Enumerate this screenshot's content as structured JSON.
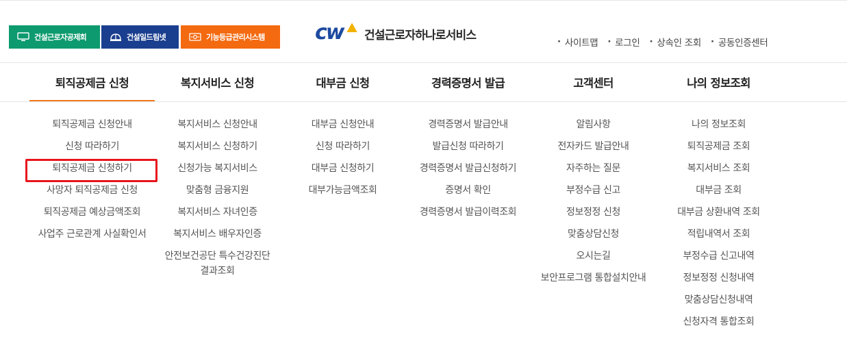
{
  "family_sites": [
    {
      "label": "건설근로자공제회",
      "icon": "monitor-icon"
    },
    {
      "label": "건설일드림넷",
      "icon": "hardhat-icon"
    },
    {
      "label": "기능등급관리시스템",
      "icon": "certificate-icon"
    }
  ],
  "logo": {
    "mark": "cw",
    "text": "건설근로자하나로서비스"
  },
  "util_links": [
    "사이트맵",
    "로그인",
    "상속인 조회",
    "공동인증센터"
  ],
  "gnb": [
    {
      "label": "퇴직공제금 신청",
      "active": true
    },
    {
      "label": "복지서비스 신청",
      "active": false
    },
    {
      "label": "대부금 신청",
      "active": false
    },
    {
      "label": "경력증명서 발급",
      "active": false
    },
    {
      "label": "고객센터",
      "active": false
    },
    {
      "label": "나의 정보조회",
      "active": false
    }
  ],
  "submenus": {
    "retirement": [
      "퇴직공제금 신청안내",
      "신청 따라하기",
      "퇴직공제금 신청하기",
      "사망자 퇴직공제금 신청",
      "퇴직공제금 예상금액조회",
      "사업주 근로관계 사실확인서"
    ],
    "welfare": [
      "복지서비스 신청안내",
      "복지서비스 신청하기",
      "신청가능 복지서비스",
      "맞춤형 금융지원",
      "복지서비스 자녀인증",
      "복지서비스 배우자인증"
    ],
    "welfare_two_line": {
      "line1": "안전보건공단 특수건강진단",
      "line2": "결과조회"
    },
    "loan": [
      "대부금 신청안내",
      "신청 따라하기",
      "대부금 신청하기",
      "대부가능금액조회"
    ],
    "career": [
      "경력증명서 발급안내",
      "발급신청 따라하기",
      "경력증명서 발급신청하기",
      "증명서 확인",
      "경력증명서 발급이력조회"
    ],
    "support": [
      "알림사항",
      "전자카드 발급안내",
      "자주하는 질문",
      "부정수급 신고",
      "정보정정 신청",
      "맞춤상담신청",
      "오시는길",
      "보안프로그램 통합설치안내"
    ],
    "myinfo": [
      "나의 정보조회",
      "퇴직공제금 조회",
      "복지서비스 조회",
      "대부금 조회",
      "대부금 상환내역 조회",
      "적립내역서 조회",
      "부정수급 신고내역",
      "정보정정 신청내역",
      "맞춤상담신청내역",
      "신청자격 통합조회"
    ]
  },
  "colors": {
    "green": "#0d9a6f",
    "navy": "#1b3f8f",
    "orange": "#f46a10",
    "active_bar": "#f07b22",
    "highlight": "#e8141c",
    "logo_blue": "#1d4aa0",
    "logo_gold": "#f2b300"
  }
}
